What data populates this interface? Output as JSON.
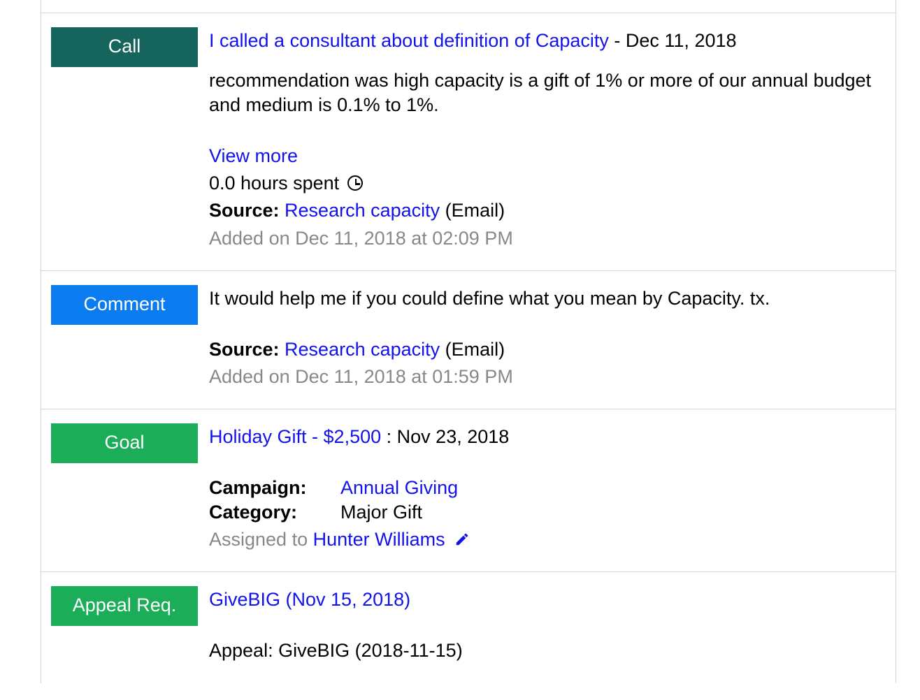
{
  "entries": [
    {
      "badge": "Call",
      "title_link": "I called a consultant about definition of Capacity",
      "title_date": "Dec 11, 2018",
      "body": "recommendation was high capacity is a gift of 1% or more of our annual budget and medium is 0.1% to 1%.",
      "view_more": "View more",
      "hours_spent": "0.0 hours spent",
      "source_label": "Source:",
      "source_link": "Research capacity",
      "source_suffix": "(Email)",
      "added": "Added on Dec 11, 2018 at 02:09 PM"
    },
    {
      "badge": "Comment",
      "body": "It would help me if you could define what you mean by Capacity. tx.",
      "source_label": "Source:",
      "source_link": "Research capacity",
      "source_suffix": "(Email)",
      "added": "Added on Dec 11, 2018 at 01:59 PM"
    },
    {
      "badge": "Goal",
      "title_link": "Holiday Gift - $2,500",
      "title_sep": " : ",
      "title_date": "Nov 23, 2018",
      "campaign_label": "Campaign:",
      "campaign_link": "Annual Giving",
      "category_label": "Category:",
      "category_value": "Major Gift",
      "assigned_prefix": "Assigned to",
      "assigned_link": "Hunter Williams"
    },
    {
      "badge": "Appeal Req.",
      "title_link": "GiveBIG (Nov 15, 2018)",
      "appeal_line": "Appeal: GiveBIG (2018-11-15)"
    }
  ]
}
